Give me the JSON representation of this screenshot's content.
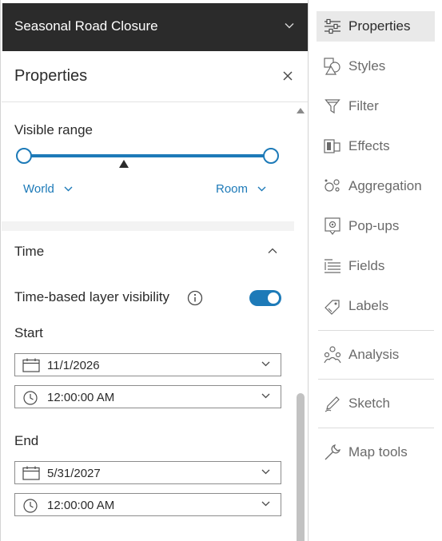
{
  "layer": {
    "title": "Seasonal Road Closure"
  },
  "properties": {
    "title": "Properties",
    "visible_range": {
      "label": "Visible range",
      "min_label": "World",
      "max_label": "Room"
    },
    "time": {
      "label": "Time",
      "toggle_label": "Time-based layer visibility",
      "toggle_on": true,
      "start_label": "Start",
      "start_date": "11/1/2026",
      "start_time": "12:00:00 AM",
      "end_label": "End",
      "end_date": "5/31/2027",
      "end_time": "12:00:00 AM"
    }
  },
  "sidebar": {
    "items": [
      {
        "label": "Properties",
        "icon": "properties-icon"
      },
      {
        "label": "Styles",
        "icon": "styles-icon"
      },
      {
        "label": "Filter",
        "icon": "filter-icon"
      },
      {
        "label": "Effects",
        "icon": "effects-icon"
      },
      {
        "label": "Aggregation",
        "icon": "aggregation-icon"
      },
      {
        "label": "Pop-ups",
        "icon": "popups-icon"
      },
      {
        "label": "Fields",
        "icon": "fields-icon"
      },
      {
        "label": "Labels",
        "icon": "labels-icon"
      },
      {
        "label": "Analysis",
        "icon": "analysis-icon"
      },
      {
        "label": "Sketch",
        "icon": "sketch-icon"
      },
      {
        "label": "Map tools",
        "icon": "map-tools-icon"
      }
    ]
  },
  "colors": {
    "accent": "#1d7ab8",
    "header_bg": "#2b2b2b",
    "active_bg": "#e9e9e9"
  }
}
